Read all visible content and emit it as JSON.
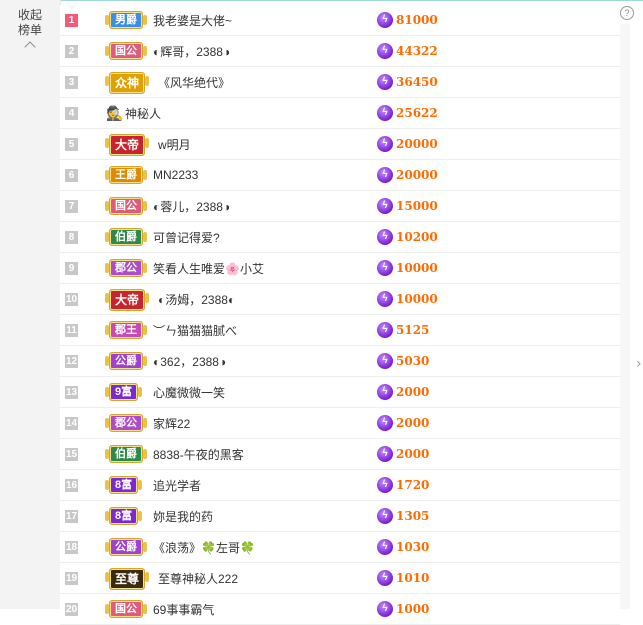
{
  "sidebar": {
    "collapse_label_1": "收起",
    "collapse_label_2": "榜单"
  },
  "help_label": "?",
  "side_arrow": "›",
  "colors": {
    "rank_top": "#f25b78",
    "rank_default": "#c8c8c8",
    "score": "#ff6b00"
  },
  "rows": [
    {
      "rank": "1",
      "badge": "男爵",
      "badge_color": "#3a8ee6",
      "name": "我老婆是大佬~",
      "score": "81000",
      "avatar": ""
    },
    {
      "rank": "2",
      "badge": "国公",
      "badge_color": "#e05a7a",
      "name": "◐辉哥，2388◑",
      "score": "44322",
      "avatar": ""
    },
    {
      "rank": "3",
      "badge": "众神",
      "badge_color": "#e0a000",
      "name": "《风华绝代》",
      "score": "36450",
      "avatar": ""
    },
    {
      "rank": "4",
      "badge": "",
      "badge_color": "",
      "name": "神秘人",
      "score": "25622",
      "avatar": "mystery-man-icon"
    },
    {
      "rank": "5",
      "badge": "大帝",
      "badge_color": "#c8242e",
      "name": "w明月",
      "score": "20000",
      "avatar": ""
    },
    {
      "rank": "6",
      "badge": "王爵",
      "badge_color": "#e08a00",
      "name": "MN2233",
      "score": "20000",
      "avatar": ""
    },
    {
      "rank": "7",
      "badge": "国公",
      "badge_color": "#e05a7a",
      "name": "◐蓉儿，2388◑",
      "score": "15000",
      "avatar": ""
    },
    {
      "rank": "8",
      "badge": "伯爵",
      "badge_color": "#2f8a4a",
      "name": "可曾记得爱?",
      "score": "10200",
      "avatar": ""
    },
    {
      "rank": "9",
      "badge": "郡公",
      "badge_color": "#b04ac8",
      "name": "笑看人生唯爱🌸小艾",
      "score": "10000",
      "avatar": ""
    },
    {
      "rank": "10",
      "badge": "大帝",
      "badge_color": "#c8242e",
      "name": "◐汤姆，2388◐",
      "score": "10000",
      "avatar": ""
    },
    {
      "rank": "11",
      "badge": "郡王",
      "badge_color": "#c84ab8",
      "name": "︶ㄣ猫猫猫腻べ",
      "score": "5125",
      "avatar": ""
    },
    {
      "rank": "12",
      "badge": "公爵",
      "badge_color": "#a040d0",
      "name": "◐362，2388◑",
      "score": "5030",
      "avatar": ""
    },
    {
      "rank": "13",
      "badge": "9富",
      "badge_color": "#7a2ad0",
      "name": "心魔微微一笑",
      "score": "2000",
      "avatar": ""
    },
    {
      "rank": "14",
      "badge": "郡公",
      "badge_color": "#b04ac8",
      "name": "家辉22",
      "score": "2000",
      "avatar": ""
    },
    {
      "rank": "15",
      "badge": "伯爵",
      "badge_color": "#2f8a4a",
      "name": "8838-午夜的黑客",
      "score": "2000",
      "avatar": ""
    },
    {
      "rank": "16",
      "badge": "8富",
      "badge_color": "#7a2ad0",
      "name": "追光学者",
      "score": "1720",
      "avatar": ""
    },
    {
      "rank": "17",
      "badge": "8富",
      "badge_color": "#7a2ad0",
      "name": "妳是我的药",
      "score": "1305",
      "avatar": ""
    },
    {
      "rank": "18",
      "badge": "公爵",
      "badge_color": "#a040d0",
      "name": "《浪荡》🍀左哥🍀",
      "score": "1030",
      "avatar": ""
    },
    {
      "rank": "19",
      "badge": "至尊",
      "badge_color": "#3a2a10",
      "name": "至尊神秘人222",
      "score": "1010",
      "avatar": ""
    },
    {
      "rank": "20",
      "badge": "国公",
      "badge_color": "#e05a7a",
      "name": "69事事霸气",
      "score": "1000",
      "avatar": ""
    }
  ]
}
